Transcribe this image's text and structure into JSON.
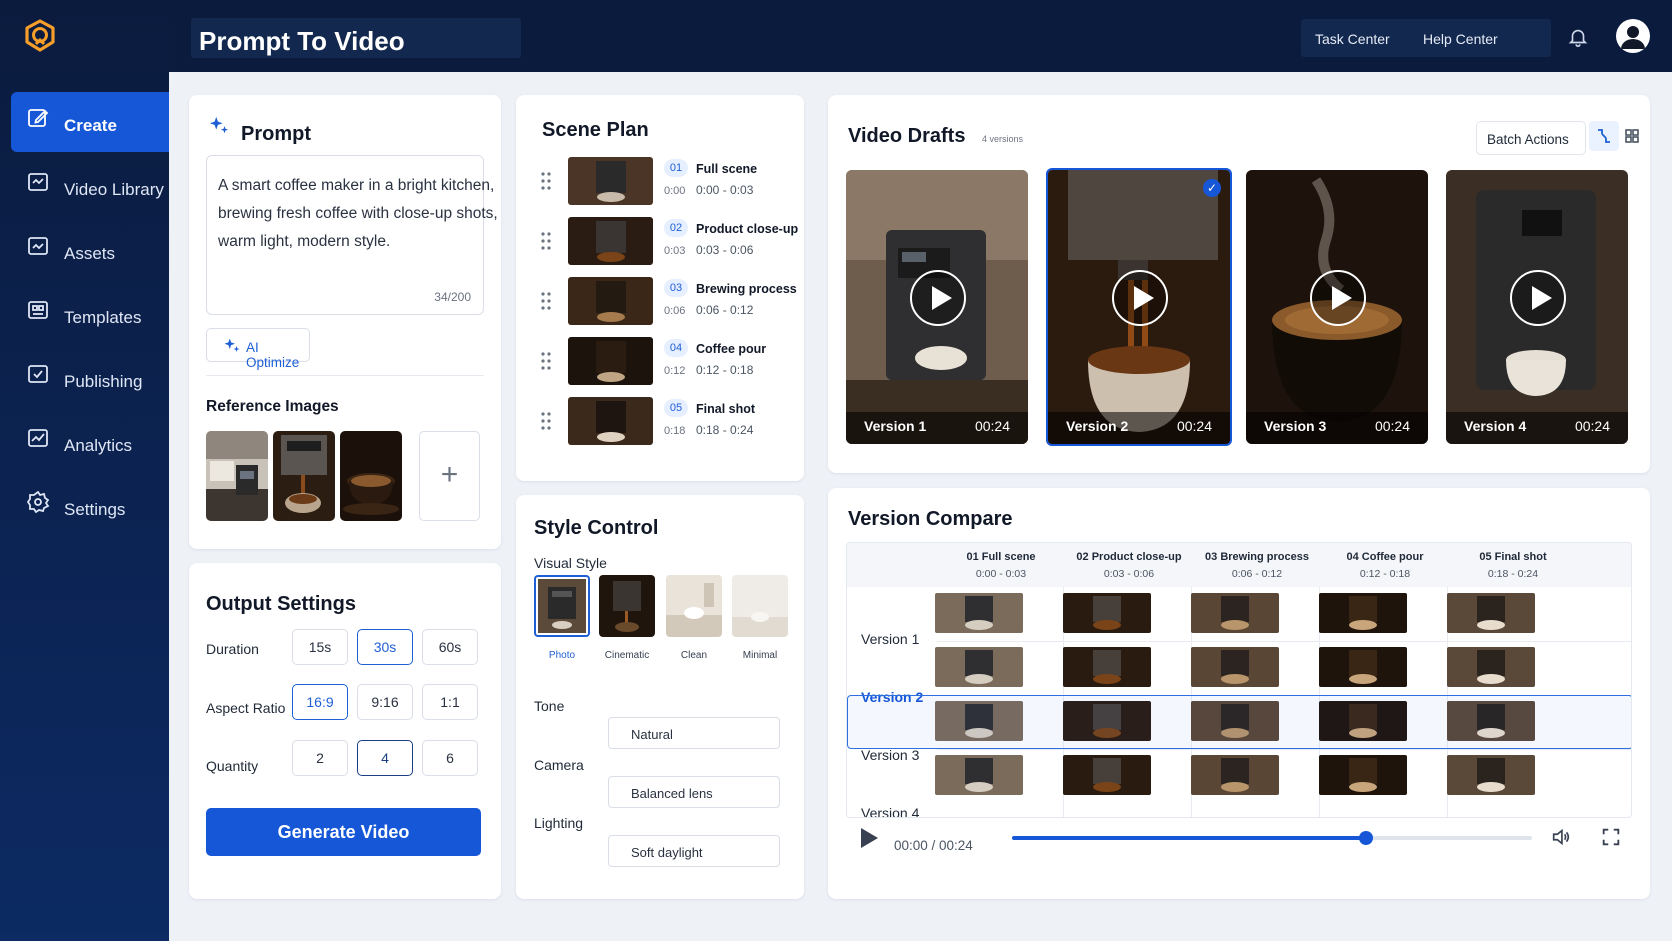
{
  "header": {
    "title": "Prompt To Video",
    "links": [
      "Task Center",
      "Help Center"
    ]
  },
  "sidebar": {
    "items": [
      {
        "label": "Create",
        "icon": "edit-icon",
        "active": true
      },
      {
        "label": "Video Library",
        "icon": "video-library-icon"
      },
      {
        "label": "Assets",
        "icon": "assets-icon"
      },
      {
        "label": "Templates",
        "icon": "templates-icon"
      },
      {
        "label": "Publishing",
        "icon": "publishing-icon"
      },
      {
        "label": "Analytics",
        "icon": "analytics-icon"
      },
      {
        "label": "Settings",
        "icon": "gear-icon"
      }
    ]
  },
  "prompt": {
    "title": "Prompt",
    "text": "A smart coffee maker in a bright kitchen, brewing fresh coffee with close-up shots, warm light, modern style.",
    "count": "34/200",
    "ai_optimize": "AI Optimize",
    "reference_title": "Reference Images"
  },
  "output": {
    "title": "Output Settings",
    "duration_label": "Duration",
    "durations": [
      "15s",
      "30s",
      "60s"
    ],
    "duration_selected": "30s",
    "aspect_label": "Aspect Ratio",
    "aspects": [
      "16:9",
      "9:16",
      "1:1"
    ],
    "aspect_selected": "16:9",
    "quantity_label": "Quantity",
    "quantities": [
      "2",
      "4",
      "6"
    ],
    "quantity_selected": "4",
    "generate": "Generate Video"
  },
  "scene_plan": {
    "title": "Scene Plan",
    "scenes": [
      {
        "num": "01",
        "start": "0:00",
        "name": "Full scene",
        "range": "0:00 - 0:03"
      },
      {
        "num": "02",
        "start": "0:03",
        "name": "Product close-up",
        "range": "0:03 - 0:06"
      },
      {
        "num": "03",
        "start": "0:06",
        "name": "Brewing process",
        "range": "0:06 - 0:12"
      },
      {
        "num": "04",
        "start": "0:12",
        "name": "Coffee pour",
        "range": "0:12 - 0:18"
      },
      {
        "num": "05",
        "start": "0:18",
        "name": "Final shot",
        "range": "0:18 - 0:24"
      }
    ]
  },
  "style": {
    "title": "Style Control",
    "visual_label": "Visual Style",
    "visual_styles": [
      "Photo",
      "Cinematic",
      "Clean",
      "Minimal"
    ],
    "visual_selected": "Photo",
    "tone_label": "Tone",
    "tone": "Natural",
    "camera_label": "Camera",
    "camera": "Balanced lens",
    "lighting_label": "Lighting",
    "lighting": "Soft daylight"
  },
  "drafts": {
    "title": "Video Drafts",
    "count": "4 versions",
    "batch": "Batch Actions",
    "versions": [
      {
        "name": "Version 1",
        "duration": "00:24"
      },
      {
        "name": "Version 2",
        "duration": "00:24",
        "selected": true
      },
      {
        "name": "Version 3",
        "duration": "00:24"
      },
      {
        "name": "Version 4",
        "duration": "00:24"
      }
    ]
  },
  "compare": {
    "title": "Version Compare",
    "columns": [
      {
        "name": "01 Full scene",
        "range": "0:00 - 0:03"
      },
      {
        "name": "02 Product close-up",
        "range": "0:03 - 0:06"
      },
      {
        "name": "03 Brewing process",
        "range": "0:06 - 0:12"
      },
      {
        "name": "04 Coffee pour",
        "range": "0:12 - 0:18"
      },
      {
        "name": "05 Final shot",
        "range": "0:18 - 0:24"
      }
    ],
    "rows": [
      "Version 1",
      "Version 2",
      "Version 3",
      "Version 4"
    ],
    "selected_row": "Version 2",
    "time": "00:00 / 00:24",
    "progress": 0.68
  },
  "colors": {
    "accent": "#1557d6",
    "sidebar": "#0b1b3e"
  }
}
